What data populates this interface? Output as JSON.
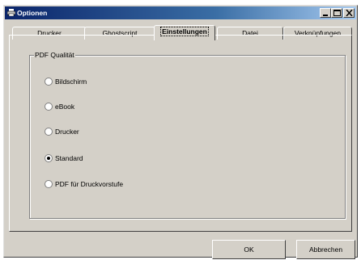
{
  "window": {
    "title": "Optionen"
  },
  "tabs": [
    {
      "label": "Drucker",
      "active": false
    },
    {
      "label": "Ghostscript",
      "active": false
    },
    {
      "label": "Einstellungen",
      "active": true
    },
    {
      "label": "Datei",
      "active": false
    },
    {
      "label": "Verknüpfungen",
      "active": false
    }
  ],
  "pdf_quality": {
    "legend": "PDF Qualität",
    "options": [
      {
        "label": "Bildschirm",
        "checked": false
      },
      {
        "label": "eBook",
        "checked": false
      },
      {
        "label": "Drucker",
        "checked": false
      },
      {
        "label": "Standard",
        "checked": true
      },
      {
        "label": "PDF für Druckvorstufe",
        "checked": false
      }
    ]
  },
  "buttons": {
    "ok": "OK",
    "cancel": "Abbrechen"
  }
}
